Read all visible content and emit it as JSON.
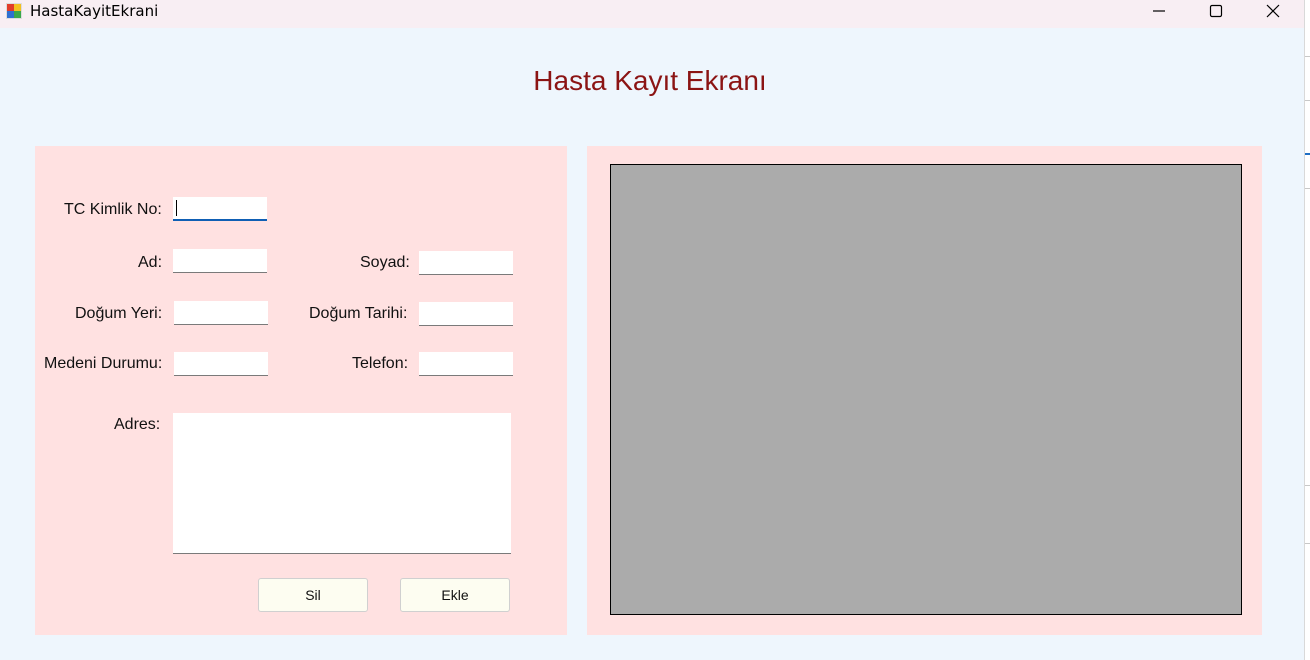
{
  "window": {
    "title": "HastaKayitEkrani",
    "controls": [
      "minimize-icon",
      "maximize-icon",
      "close-icon"
    ]
  },
  "heading": "Hasta Kayıt Ekranı",
  "form": {
    "tc_label": "TC Kimlik No:",
    "tc_value": "",
    "ad_label": "Ad:",
    "ad_value": "",
    "soyad_label": "Soyad:",
    "soyad_value": "",
    "dogum_yeri_label": "Doğum Yeri:",
    "dogum_yeri_value": "",
    "dogum_tarihi_label": "Doğum Tarihi:",
    "dogum_tarihi_value": "",
    "medeni_label": "Medeni Durumu:",
    "medeni_value": "",
    "telefon_label": "Telefon:",
    "telefon_value": "",
    "adres_label": "Adres:",
    "adres_value": ""
  },
  "buttons": {
    "delete_label": "Sil",
    "add_label": "Ekle"
  },
  "colors": {
    "background": "#eef6fd",
    "panel": "#ffe1e1",
    "heading": "#8b1414",
    "picture": "#ababab"
  }
}
